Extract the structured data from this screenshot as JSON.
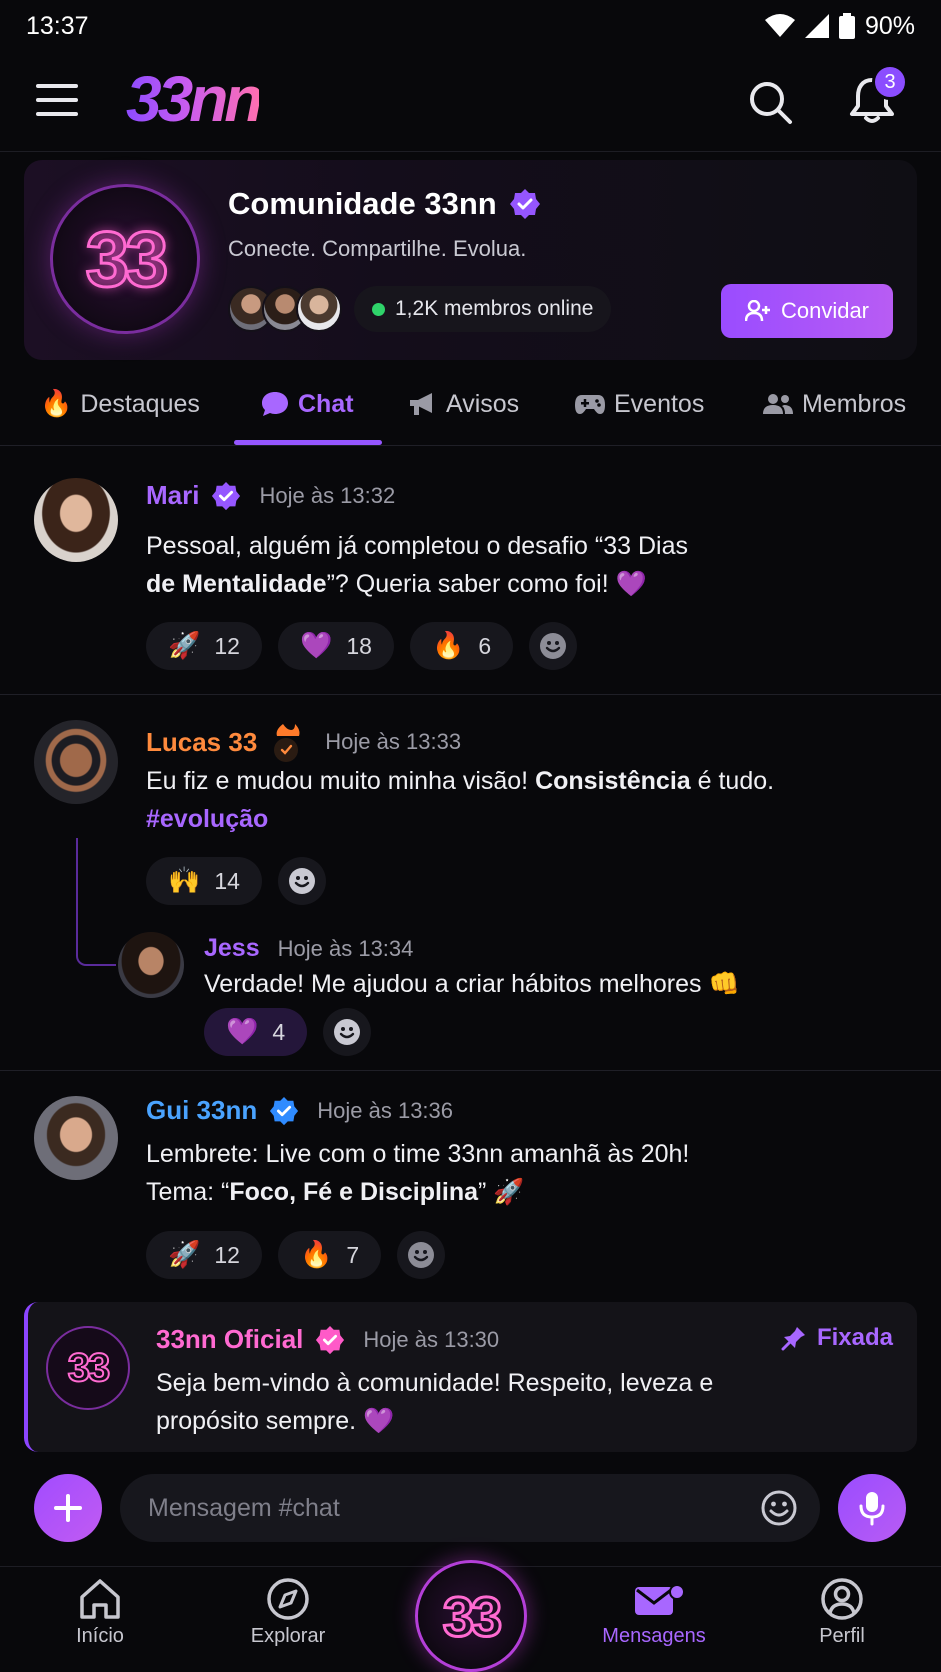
{
  "status_bar": {
    "time": "13:37",
    "battery": "90%"
  },
  "header": {
    "logo": "33nn",
    "notification_count": "3"
  },
  "community": {
    "logo_text": "33",
    "title": "Comunidade 33nn",
    "subtitle": "Conecte. Compartilhe. Evolua.",
    "online": "1,2K membros online",
    "invite_label": "Convidar"
  },
  "tabs": [
    {
      "label": "Destaques",
      "icon": "fire-icon"
    },
    {
      "label": "Chat",
      "icon": "chat-bubble-icon"
    },
    {
      "label": "Avisos",
      "icon": "megaphone-icon"
    },
    {
      "label": "Eventos",
      "icon": "gamepad-icon"
    },
    {
      "label": "Membros",
      "icon": "people-icon"
    }
  ],
  "messages": [
    {
      "name": "Mari",
      "time": "Hoje às 13:32",
      "name_color": "#a867ff",
      "text_1": "Pessoal, alguém já completou o desafio “33 Dias",
      "text_2_bold": "de Mentalidade",
      "text_2_rest": "”? Queria saber como foi! 💜",
      "reactions": [
        {
          "emoji": "🚀",
          "count": "12"
        },
        {
          "emoji": "💜",
          "count": "18"
        },
        {
          "emoji": "🔥",
          "count": "6"
        }
      ]
    },
    {
      "name": "Lucas 33",
      "time": "Hoje às 13:33",
      "name_color": "#ff8a3d",
      "text_1_pre": "Eu fiz e mudou muito minha visão! ",
      "text_1_bold": "Consistência",
      "text_1_post": " é tudo.",
      "hashtag": "#evolução",
      "reactions": [
        {
          "emoji": "🙌",
          "count": "14"
        }
      ]
    },
    {
      "name": "Jess",
      "time": "Hoje às 13:34",
      "name_color": "#a867ff",
      "text": "Verdade! Me ajudou a criar hábitos melhores 👊",
      "reactions": [
        {
          "emoji": "💜",
          "count": "4"
        }
      ]
    },
    {
      "name": "Gui 33nn",
      "time": "Hoje às 13:36",
      "name_color": "#4aa3ff",
      "text_1": "Lembrete: Live com o time 33nn amanhã às 20h!",
      "text_2_pre": "Tema: “",
      "text_2_bold": "Foco, Fé e Disciplina",
      "text_2_post": "” 🚀",
      "reactions": [
        {
          "emoji": "🚀",
          "count": "12"
        },
        {
          "emoji": "🔥",
          "count": "7"
        }
      ]
    }
  ],
  "pinned": {
    "logo_text": "33",
    "name": "33nn Oficial",
    "time": "Hoje às 13:30",
    "label": "Fixada",
    "text_1": "Seja bem-vindo à comunidade! Respeito, leveza e",
    "text_2": "propósito sempre. 💜"
  },
  "composer": {
    "placeholder": "Mensagem #chat"
  },
  "bottom_nav": {
    "items": [
      {
        "label": "Início",
        "icon": "home-icon"
      },
      {
        "label": "Explorar",
        "icon": "compass-icon"
      },
      {
        "label": "Mensagens",
        "icon": "mail-icon"
      },
      {
        "label": "Perfil",
        "icon": "profile-icon"
      }
    ],
    "center_text": "33"
  },
  "colors": {
    "accent": "#9556ff",
    "online": "#2fd36a",
    "background": "#08080b"
  }
}
